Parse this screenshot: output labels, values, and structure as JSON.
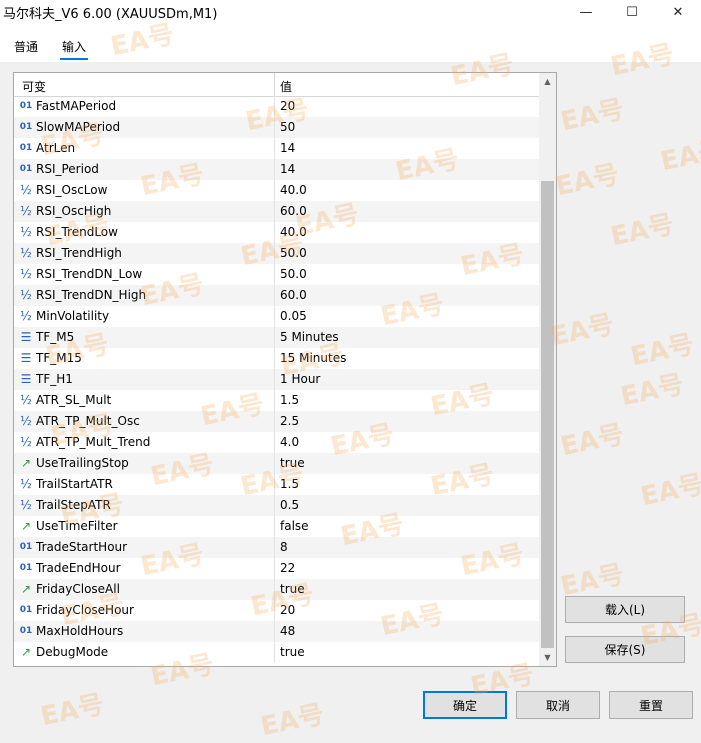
{
  "window": {
    "title": "马尔科夫_V6 6.00 (XAUUSDm,M1)",
    "minimize": "—",
    "maximize": "☐",
    "close": "✕"
  },
  "tabs": [
    {
      "label": "普通"
    },
    {
      "label": "输入"
    }
  ],
  "grid": {
    "col_variable": "可变",
    "col_value": "值",
    "rows": [
      {
        "name": "FastMAPeriod",
        "value": "20",
        "type": "int",
        "icon": "01"
      },
      {
        "name": "SlowMAPeriod",
        "value": "50",
        "type": "int",
        "icon": "01"
      },
      {
        "name": "AtrLen",
        "value": "14",
        "type": "int",
        "icon": "01"
      },
      {
        "name": "RSI_Period",
        "value": "14",
        "type": "int",
        "icon": "01"
      },
      {
        "name": "RSI_OscLow",
        "value": "40.0",
        "type": "dbl",
        "icon": "½"
      },
      {
        "name": "RSI_OscHigh",
        "value": "60.0",
        "type": "dbl",
        "icon": "½"
      },
      {
        "name": "RSI_TrendLow",
        "value": "40.0",
        "type": "dbl",
        "icon": "½"
      },
      {
        "name": "RSI_TrendHigh",
        "value": "50.0",
        "type": "dbl",
        "icon": "½"
      },
      {
        "name": "RSI_TrendDN_Low",
        "value": "50.0",
        "type": "dbl",
        "icon": "½"
      },
      {
        "name": "RSI_TrendDN_High",
        "value": "60.0",
        "type": "dbl",
        "icon": "½"
      },
      {
        "name": "MinVolatility",
        "value": "0.05",
        "type": "dbl",
        "icon": "½"
      },
      {
        "name": "TF_M5",
        "value": "5 Minutes",
        "type": "enum",
        "icon": "☰"
      },
      {
        "name": "TF_M15",
        "value": "15 Minutes",
        "type": "enum",
        "icon": "☰"
      },
      {
        "name": "TF_H1",
        "value": "1 Hour",
        "type": "enum",
        "icon": "☰"
      },
      {
        "name": "ATR_SL_Mult",
        "value": "1.5",
        "type": "dbl",
        "icon": "½"
      },
      {
        "name": "ATR_TP_Mult_Osc",
        "value": "2.5",
        "type": "dbl",
        "icon": "½"
      },
      {
        "name": "ATR_TP_Mult_Trend",
        "value": "4.0",
        "type": "dbl",
        "icon": "½"
      },
      {
        "name": "UseTrailingStop",
        "value": "true",
        "type": "bool",
        "icon": "↗"
      },
      {
        "name": "TrailStartATR",
        "value": "1.5",
        "type": "dbl",
        "icon": "½"
      },
      {
        "name": "TrailStepATR",
        "value": "0.5",
        "type": "dbl",
        "icon": "½"
      },
      {
        "name": "UseTimeFilter",
        "value": "false",
        "type": "bool",
        "icon": "↗"
      },
      {
        "name": "TradeStartHour",
        "value": "8",
        "type": "int",
        "icon": "01"
      },
      {
        "name": "TradeEndHour",
        "value": "22",
        "type": "int",
        "icon": "01"
      },
      {
        "name": "FridayCloseAll",
        "value": "true",
        "type": "bool",
        "icon": "↗"
      },
      {
        "name": "FridayCloseHour",
        "value": "20",
        "type": "int",
        "icon": "01"
      },
      {
        "name": "MaxHoldHours",
        "value": "48",
        "type": "int",
        "icon": "01"
      },
      {
        "name": "DebugMode",
        "value": "true",
        "type": "bool",
        "icon": "↗"
      }
    ],
    "scroll_up": "▲",
    "scroll_down": "▼"
  },
  "buttons": {
    "load": "载入(L)",
    "save": "保存(S)",
    "ok": "确定",
    "cancel": "取消",
    "reset": "重置"
  },
  "watermark": "EA号"
}
